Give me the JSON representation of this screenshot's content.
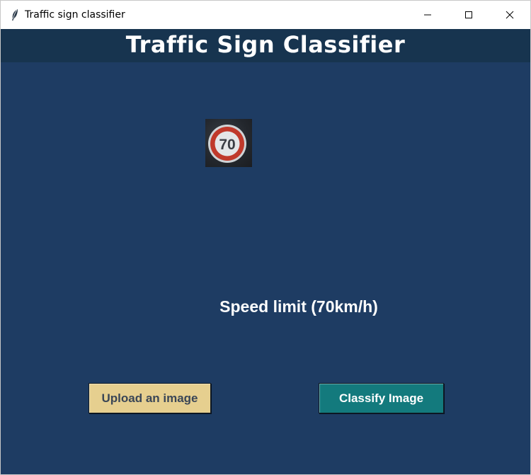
{
  "window": {
    "title": "Traffic sign classifier",
    "icon": "feather-icon",
    "controls": [
      "minimize-icon",
      "maximize-icon",
      "close-icon"
    ]
  },
  "header": {
    "title": "Traffic Sign Classifier"
  },
  "image": {
    "sign_value": "70",
    "description_icon": "speed-limit-sign-image"
  },
  "result": {
    "label": "Speed limit (70km/h)"
  },
  "buttons": {
    "upload_label": "Upload an image",
    "classify_label": "Classify Image"
  },
  "colors": {
    "background": "#1e3c63",
    "header": "#17344f",
    "upload_button": "#e6cf8f",
    "classify_button": "#137a7d"
  }
}
